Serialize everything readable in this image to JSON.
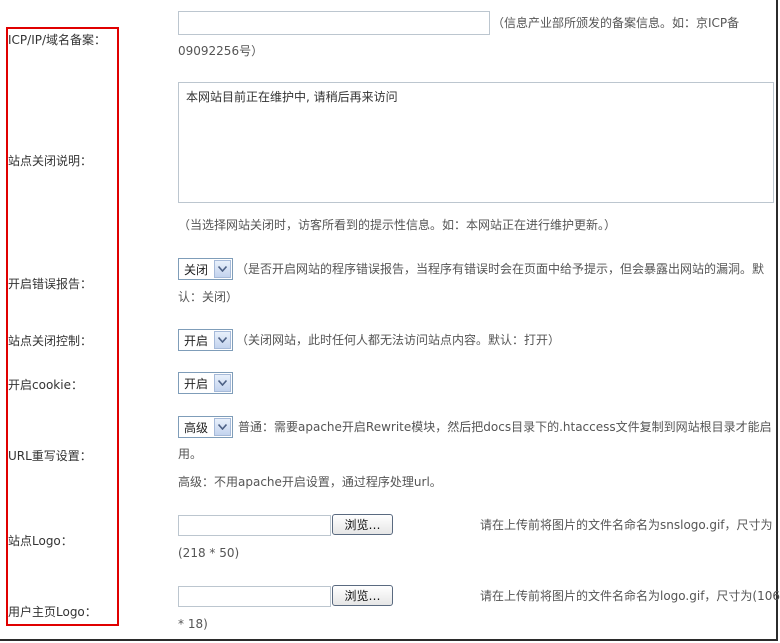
{
  "labels": {
    "icp": "ICP/IP/域名备案：",
    "close_desc": "站点关闭说明：",
    "error_report": "开启错误报告：",
    "site_close": "站点关闭控制：",
    "cookie": "开启cookie：",
    "url_rewrite": "URL重写设置：",
    "site_logo": "站点Logo：",
    "user_logo": "用户主页Logo："
  },
  "icp": {
    "value": "",
    "hint_line1": "（信息产业部所颁发的备案信息。如：京ICP备",
    "hint_line2": "09092256号）"
  },
  "close_desc": {
    "value": "本网站目前正在维护中, 请稍后再来访问",
    "hint": "（当选择网站关闭时，访客所看到的提示性信息。如：本网站正在进行维护更新。）"
  },
  "error_report": {
    "selected": "关闭",
    "hint_line1": "（是否开启网站的程序错误报告，当程序有错误时会在页面中给予提示，但会暴露出网站的漏洞。默",
    "hint_line2": "认：关闭）"
  },
  "site_close": {
    "selected": "开启",
    "hint": "（关闭网站，此时任何人都无法访问站点内容。默认：打开）"
  },
  "cookie": {
    "selected": "开启"
  },
  "url_rewrite": {
    "selected": "高级",
    "hint_line1": "普通：需要apache开启Rewrite模块，然后把docs目录下的.htaccess文件复制到网站根目录才能启",
    "hint_line2": "用。",
    "hint_line3": "高级：不用apache开启设置，通过程序处理url。"
  },
  "site_logo": {
    "browse_label": "浏览…",
    "hint_line1": "请在上传前将图片的文件名命名为snslogo.gif，尺寸为",
    "hint_line2": "(218 * 50)"
  },
  "user_logo": {
    "browse_label": "浏览…",
    "hint_line1": "请在上传前将图片的文件名命名为logo.gif，尺寸为(106",
    "hint_line2": "* 18)"
  },
  "colors": {
    "highlight_border": "#e00000",
    "input_border": "#bcc6cf",
    "hint_text": "#555555"
  }
}
